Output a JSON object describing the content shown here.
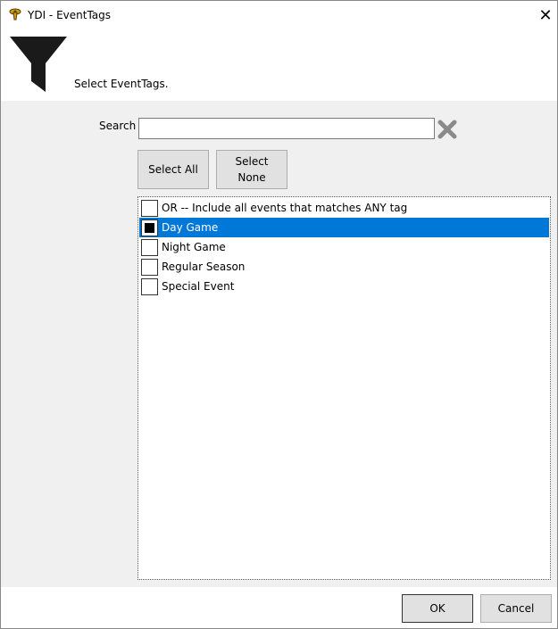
{
  "window": {
    "title": "YDI - EventTags",
    "close_glyph": "✕"
  },
  "header": {
    "icon": "funnel-icon",
    "prompt": "Select EventTags."
  },
  "search": {
    "label": "Search",
    "value": "",
    "placeholder": "",
    "clear_icon": "clear-x-icon"
  },
  "actions": {
    "select_all_label": "Select All",
    "select_none_label": "Select\nNone"
  },
  "tag_list": {
    "items": [
      {
        "label": "OR -- Include all events that matches ANY tag",
        "checked": false,
        "selected": false
      },
      {
        "label": "Day Game",
        "checked": true,
        "selected": true
      },
      {
        "label": "Night Game",
        "checked": false,
        "selected": false
      },
      {
        "label": "Regular Season",
        "checked": false,
        "selected": false
      },
      {
        "label": "Special Event",
        "checked": false,
        "selected": false
      }
    ]
  },
  "footer": {
    "ok_label": "OK",
    "cancel_label": "Cancel"
  },
  "colors": {
    "selection": "#0078d7",
    "clear_icon": "#8a8a8a",
    "funnel": "#1a1a1a"
  }
}
